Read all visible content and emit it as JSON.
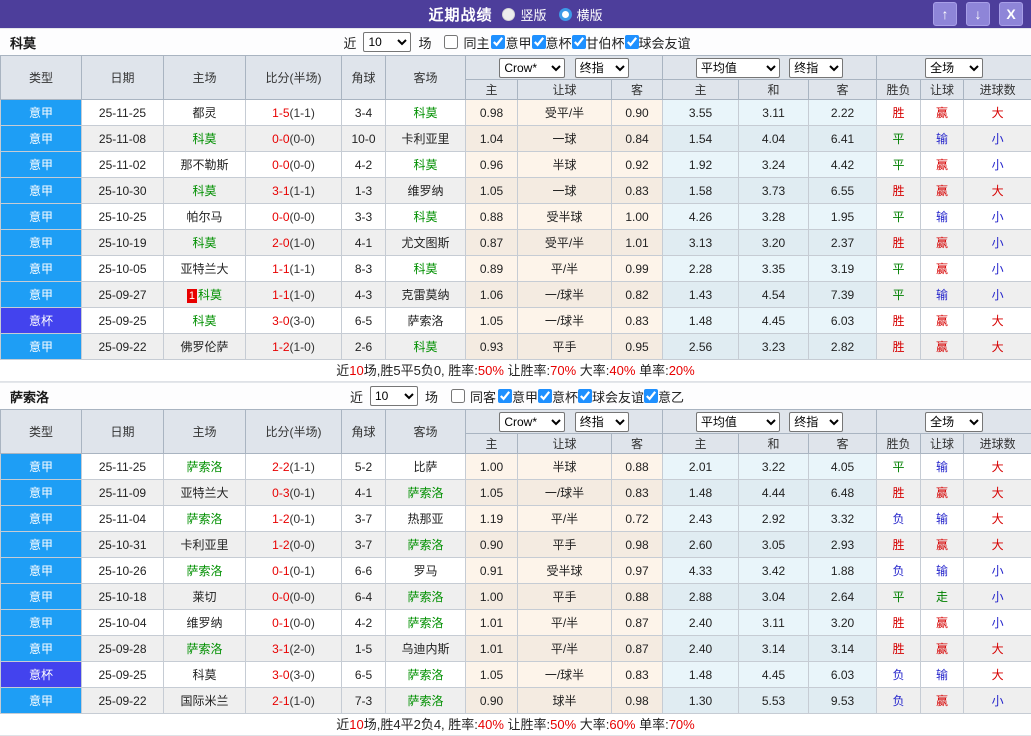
{
  "window": {
    "title": "近期战绩",
    "view_modes": [
      {
        "label": "竖版",
        "selected": true
      },
      {
        "label": "横版",
        "selected": false
      }
    ],
    "buttons": {
      "up": "↑",
      "down": "↓",
      "close": "X"
    }
  },
  "table_columns": {
    "left": [
      "类型",
      "日期",
      "主场",
      "比分(半场)",
      "角球",
      "客场"
    ],
    "odds_group": [
      "主",
      "让球",
      "客"
    ],
    "avg_group": [
      "主",
      "和",
      "客"
    ],
    "result_group": [
      "胜负",
      "让球",
      "进球数"
    ],
    "selects": {
      "odds_source": "Crow*",
      "odds_stage": "终指",
      "avg_source": "平均值",
      "avg_stage": "终指",
      "scope": "全场"
    }
  },
  "sections": [
    {
      "team": "科莫",
      "filter": {
        "prefix": "近",
        "count": "10",
        "suffix": "场",
        "same": {
          "label": "同主",
          "checked": false
        },
        "leagues": [
          {
            "label": "意甲",
            "checked": true
          },
          {
            "label": "意杯",
            "checked": true
          },
          {
            "label": "甘伯杯",
            "checked": true
          },
          {
            "label": "球会友谊",
            "checked": true
          }
        ]
      },
      "rows": [
        {
          "type": "意甲",
          "cup": false,
          "date": "25-11-25",
          "home": "都灵",
          "home_green": false,
          "badge": "",
          "score": "1-5",
          "half": "(1-1)",
          "corner": "3-4",
          "away": "科莫",
          "away_green": true,
          "odds": [
            "0.98",
            "受平/半",
            "0.90"
          ],
          "avg": [
            "3.55",
            "3.11",
            "2.22"
          ],
          "res": [
            "胜",
            "赢",
            "大"
          ],
          "resc": [
            "r",
            "r",
            "r"
          ]
        },
        {
          "type": "意甲",
          "cup": false,
          "date": "25-11-08",
          "home": "科莫",
          "home_green": true,
          "badge": "",
          "score": "0-0",
          "half": "(0-0)",
          "corner": "10-0",
          "away": "卡利亚里",
          "away_green": false,
          "odds": [
            "1.04",
            "一球",
            "0.84"
          ],
          "avg": [
            "1.54",
            "4.04",
            "6.41"
          ],
          "res": [
            "平",
            "输",
            "小"
          ],
          "resc": [
            "g",
            "b",
            "b"
          ]
        },
        {
          "type": "意甲",
          "cup": false,
          "date": "25-11-02",
          "home": "那不勒斯",
          "home_green": false,
          "badge": "",
          "score": "0-0",
          "half": "(0-0)",
          "corner": "4-2",
          "away": "科莫",
          "away_green": true,
          "odds": [
            "0.96",
            "半球",
            "0.92"
          ],
          "avg": [
            "1.92",
            "3.24",
            "4.42"
          ],
          "res": [
            "平",
            "赢",
            "小"
          ],
          "resc": [
            "g",
            "r",
            "b"
          ]
        },
        {
          "type": "意甲",
          "cup": false,
          "date": "25-10-30",
          "home": "科莫",
          "home_green": true,
          "badge": "",
          "score": "3-1",
          "half": "(1-1)",
          "corner": "1-3",
          "away": "维罗纳",
          "away_green": false,
          "odds": [
            "1.05",
            "一球",
            "0.83"
          ],
          "avg": [
            "1.58",
            "3.73",
            "6.55"
          ],
          "res": [
            "胜",
            "赢",
            "大"
          ],
          "resc": [
            "r",
            "r",
            "r"
          ]
        },
        {
          "type": "意甲",
          "cup": false,
          "date": "25-10-25",
          "home": "帕尔马",
          "home_green": false,
          "badge": "",
          "score": "0-0",
          "half": "(0-0)",
          "corner": "3-3",
          "away": "科莫",
          "away_green": true,
          "odds": [
            "0.88",
            "受半球",
            "1.00"
          ],
          "avg": [
            "4.26",
            "3.28",
            "1.95"
          ],
          "res": [
            "平",
            "输",
            "小"
          ],
          "resc": [
            "g",
            "b",
            "b"
          ]
        },
        {
          "type": "意甲",
          "cup": false,
          "date": "25-10-19",
          "home": "科莫",
          "home_green": true,
          "badge": "",
          "score": "2-0",
          "half": "(1-0)",
          "corner": "4-1",
          "away": "尤文图斯",
          "away_green": false,
          "odds": [
            "0.87",
            "受平/半",
            "1.01"
          ],
          "avg": [
            "3.13",
            "3.20",
            "2.37"
          ],
          "res": [
            "胜",
            "赢",
            "小"
          ],
          "resc": [
            "r",
            "r",
            "b"
          ]
        },
        {
          "type": "意甲",
          "cup": false,
          "date": "25-10-05",
          "home": "亚特兰大",
          "home_green": false,
          "badge": "",
          "score": "1-1",
          "half": "(1-1)",
          "corner": "8-3",
          "away": "科莫",
          "away_green": true,
          "odds": [
            "0.89",
            "平/半",
            "0.99"
          ],
          "avg": [
            "2.28",
            "3.35",
            "3.19"
          ],
          "res": [
            "平",
            "赢",
            "小"
          ],
          "resc": [
            "g",
            "r",
            "b"
          ]
        },
        {
          "type": "意甲",
          "cup": false,
          "date": "25-09-27",
          "home": "科莫",
          "home_green": true,
          "badge": "1",
          "score": "1-1",
          "half": "(1-0)",
          "corner": "4-3",
          "away": "克雷莫纳",
          "away_green": false,
          "odds": [
            "1.06",
            "一/球半",
            "0.82"
          ],
          "avg": [
            "1.43",
            "4.54",
            "7.39"
          ],
          "res": [
            "平",
            "输",
            "小"
          ],
          "resc": [
            "g",
            "b",
            "b"
          ]
        },
        {
          "type": "意杯",
          "cup": true,
          "date": "25-09-25",
          "home": "科莫",
          "home_green": true,
          "badge": "",
          "score": "3-0",
          "half": "(3-0)",
          "corner": "6-5",
          "away": "萨索洛",
          "away_green": false,
          "odds": [
            "1.05",
            "一/球半",
            "0.83"
          ],
          "avg": [
            "1.48",
            "4.45",
            "6.03"
          ],
          "res": [
            "胜",
            "赢",
            "大"
          ],
          "resc": [
            "r",
            "r",
            "r"
          ]
        },
        {
          "type": "意甲",
          "cup": false,
          "date": "25-09-22",
          "home": "佛罗伦萨",
          "home_green": false,
          "badge": "",
          "score": "1-2",
          "half": "(1-0)",
          "corner": "2-6",
          "away": "科莫",
          "away_green": true,
          "odds": [
            "0.93",
            "平手",
            "0.95"
          ],
          "avg": [
            "2.56",
            "3.23",
            "2.82"
          ],
          "res": [
            "胜",
            "赢",
            "大"
          ],
          "resc": [
            "r",
            "r",
            "r"
          ]
        }
      ],
      "summary": [
        [
          "近",
          "k"
        ],
        [
          "10",
          "r"
        ],
        [
          "场,胜5平5负0, 胜率:",
          "k"
        ],
        [
          "50%",
          "r"
        ],
        [
          " 让胜率:",
          "k"
        ],
        [
          "70%",
          "r"
        ],
        [
          " 大率:",
          "k"
        ],
        [
          "40%",
          "r"
        ],
        [
          " 单率:",
          "k"
        ],
        [
          "20%",
          "r"
        ]
      ]
    },
    {
      "team": "萨索洛",
      "filter": {
        "prefix": "近",
        "count": "10",
        "suffix": "场",
        "same": {
          "label": "同客",
          "checked": false
        },
        "leagues": [
          {
            "label": "意甲",
            "checked": true
          },
          {
            "label": "意杯",
            "checked": true
          },
          {
            "label": "球会友谊",
            "checked": true
          },
          {
            "label": "意乙",
            "checked": true
          }
        ]
      },
      "rows": [
        {
          "type": "意甲",
          "cup": false,
          "date": "25-11-25",
          "home": "萨索洛",
          "home_green": true,
          "badge": "",
          "score": "2-2",
          "half": "(1-1)",
          "corner": "5-2",
          "away": "比萨",
          "away_green": false,
          "odds": [
            "1.00",
            "半球",
            "0.88"
          ],
          "avg": [
            "2.01",
            "3.22",
            "4.05"
          ],
          "res": [
            "平",
            "输",
            "大"
          ],
          "resc": [
            "g",
            "b",
            "r"
          ]
        },
        {
          "type": "意甲",
          "cup": false,
          "date": "25-11-09",
          "home": "亚特兰大",
          "home_green": false,
          "badge": "",
          "score": "0-3",
          "half": "(0-1)",
          "corner": "4-1",
          "away": "萨索洛",
          "away_green": true,
          "odds": [
            "1.05",
            "一/球半",
            "0.83"
          ],
          "avg": [
            "1.48",
            "4.44",
            "6.48"
          ],
          "res": [
            "胜",
            "赢",
            "大"
          ],
          "resc": [
            "r",
            "r",
            "r"
          ]
        },
        {
          "type": "意甲",
          "cup": false,
          "date": "25-11-04",
          "home": "萨索洛",
          "home_green": true,
          "badge": "",
          "score": "1-2",
          "half": "(0-1)",
          "corner": "3-7",
          "away": "热那亚",
          "away_green": false,
          "odds": [
            "1.19",
            "平/半",
            "0.72"
          ],
          "avg": [
            "2.43",
            "2.92",
            "3.32"
          ],
          "res": [
            "负",
            "输",
            "大"
          ],
          "resc": [
            "b",
            "b",
            "r"
          ]
        },
        {
          "type": "意甲",
          "cup": false,
          "date": "25-10-31",
          "home": "卡利亚里",
          "home_green": false,
          "badge": "",
          "score": "1-2",
          "half": "(0-0)",
          "corner": "3-7",
          "away": "萨索洛",
          "away_green": true,
          "odds": [
            "0.90",
            "平手",
            "0.98"
          ],
          "avg": [
            "2.60",
            "3.05",
            "2.93"
          ],
          "res": [
            "胜",
            "赢",
            "大"
          ],
          "resc": [
            "r",
            "r",
            "r"
          ]
        },
        {
          "type": "意甲",
          "cup": false,
          "date": "25-10-26",
          "home": "萨索洛",
          "home_green": true,
          "badge": "",
          "score": "0-1",
          "half": "(0-1)",
          "corner": "6-6",
          "away": "罗马",
          "away_green": false,
          "odds": [
            "0.91",
            "受半球",
            "0.97"
          ],
          "avg": [
            "4.33",
            "3.42",
            "1.88"
          ],
          "res": [
            "负",
            "输",
            "小"
          ],
          "resc": [
            "b",
            "b",
            "b"
          ]
        },
        {
          "type": "意甲",
          "cup": false,
          "date": "25-10-18",
          "home": "莱切",
          "home_green": false,
          "badge": "",
          "score": "0-0",
          "half": "(0-0)",
          "corner": "6-4",
          "away": "萨索洛",
          "away_green": true,
          "odds": [
            "1.00",
            "平手",
            "0.88"
          ],
          "avg": [
            "2.88",
            "3.04",
            "2.64"
          ],
          "res": [
            "平",
            "走",
            "小"
          ],
          "resc": [
            "g",
            "g",
            "b"
          ]
        },
        {
          "type": "意甲",
          "cup": false,
          "date": "25-10-04",
          "home": "维罗纳",
          "home_green": false,
          "badge": "",
          "score": "0-1",
          "half": "(0-0)",
          "corner": "4-2",
          "away": "萨索洛",
          "away_green": true,
          "odds": [
            "1.01",
            "平/半",
            "0.87"
          ],
          "avg": [
            "2.40",
            "3.11",
            "3.20"
          ],
          "res": [
            "胜",
            "赢",
            "小"
          ],
          "resc": [
            "r",
            "r",
            "b"
          ]
        },
        {
          "type": "意甲",
          "cup": false,
          "date": "25-09-28",
          "home": "萨索洛",
          "home_green": true,
          "badge": "",
          "score": "3-1",
          "half": "(2-0)",
          "corner": "1-5",
          "away": "乌迪内斯",
          "away_green": false,
          "odds": [
            "1.01",
            "平/半",
            "0.87"
          ],
          "avg": [
            "2.40",
            "3.14",
            "3.14"
          ],
          "res": [
            "胜",
            "赢",
            "大"
          ],
          "resc": [
            "r",
            "r",
            "r"
          ]
        },
        {
          "type": "意杯",
          "cup": true,
          "date": "25-09-25",
          "home": "科莫",
          "home_green": false,
          "badge": "",
          "score": "3-0",
          "half": "(3-0)",
          "corner": "6-5",
          "away": "萨索洛",
          "away_green": true,
          "odds": [
            "1.05",
            "一/球半",
            "0.83"
          ],
          "avg": [
            "1.48",
            "4.45",
            "6.03"
          ],
          "res": [
            "负",
            "输",
            "大"
          ],
          "resc": [
            "b",
            "b",
            "r"
          ]
        },
        {
          "type": "意甲",
          "cup": false,
          "date": "25-09-22",
          "home": "国际米兰",
          "home_green": false,
          "badge": "",
          "score": "2-1",
          "half": "(1-0)",
          "corner": "7-3",
          "away": "萨索洛",
          "away_green": true,
          "odds": [
            "0.90",
            "球半",
            "0.98"
          ],
          "avg": [
            "1.30",
            "5.53",
            "9.53"
          ],
          "res": [
            "负",
            "赢",
            "小"
          ],
          "resc": [
            "b",
            "r",
            "b"
          ]
        }
      ],
      "summary": [
        [
          "近",
          "k"
        ],
        [
          "10",
          "r"
        ],
        [
          "场,胜4平2负4, 胜率:",
          "k"
        ],
        [
          "40%",
          "r"
        ],
        [
          " 让胜率:",
          "k"
        ],
        [
          "50%",
          "r"
        ],
        [
          " 大率:",
          "k"
        ],
        [
          "60%",
          "r"
        ],
        [
          " 单率:",
          "k"
        ],
        [
          "70%",
          "r"
        ]
      ]
    }
  ]
}
